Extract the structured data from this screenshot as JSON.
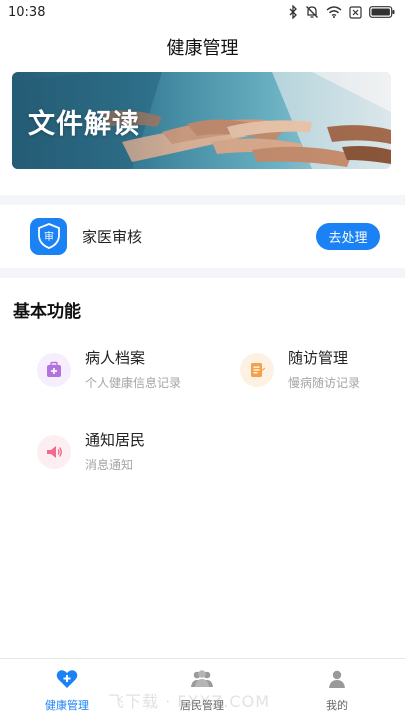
{
  "status_bar": {
    "time": "10:38"
  },
  "header": {
    "title": "健康管理"
  },
  "banner": {
    "title": "文件解读"
  },
  "review": {
    "icon_glyph": "审",
    "label": "家医审核",
    "button_label": "去处理"
  },
  "section": {
    "title": "基本功能"
  },
  "functions": [
    {
      "name": "病人档案",
      "desc": "个人健康信息记录",
      "icon": "medical-kit-icon",
      "color": "#b073e0"
    },
    {
      "name": "随访管理",
      "desc": "慢病随访记录",
      "icon": "clipboard-icon",
      "color": "#f5a04a"
    },
    {
      "name": "通知居民",
      "desc": "消息通知",
      "icon": "speaker-icon",
      "color": "#f26b8c"
    }
  ],
  "tabs": [
    {
      "label": "健康管理",
      "icon": "heart-plus-icon",
      "active": true
    },
    {
      "label": "居民管理",
      "icon": "users-icon",
      "active": false
    },
    {
      "label": "我的",
      "icon": "person-icon",
      "active": false
    }
  ],
  "watermark": "飞下载 · FXXZ.COM",
  "colors": {
    "primary": "#1a82f5",
    "divider": "#f4f5f9"
  }
}
